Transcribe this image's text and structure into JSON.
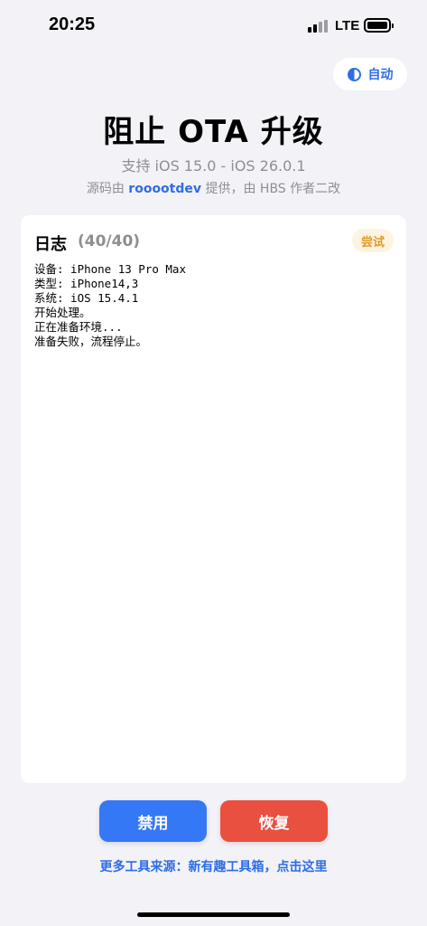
{
  "status_bar": {
    "time": "20:25",
    "network": "LTE",
    "icons": [
      "signal-icon",
      "battery-icon"
    ]
  },
  "theme_toggle": {
    "icon": "contrast-icon",
    "label": "自动"
  },
  "header": {
    "title": "阻止 OTA 升级",
    "subtitle": "支持 iOS 15.0 - iOS 26.0.1",
    "credits_prefix": "源码由 ",
    "credits_author": "roooot​dev",
    "credits_suffix": " 提供，由 HBS 作者二改"
  },
  "log": {
    "title": "日志",
    "count": "(40/40)",
    "badge": "尝试",
    "lines": [
      "设备: iPhone 13 Pro Max",
      "类型: iPhone14,3",
      "系统: iOS 15.4.1",
      "开始处理。",
      "正在准备环境...",
      "准备失败，流程停止。"
    ]
  },
  "actions": {
    "disable_label": "禁用",
    "restore_label": "恢复"
  },
  "footer": {
    "more_tools": "更多工具来源：新有趣工具箱，点击这里"
  },
  "colors": {
    "accent_blue": "#2f6de5",
    "button_blue": "#3478f6",
    "button_red": "#e9503f",
    "badge_orange": "#e39a2a",
    "background": "#f2f2f7"
  }
}
